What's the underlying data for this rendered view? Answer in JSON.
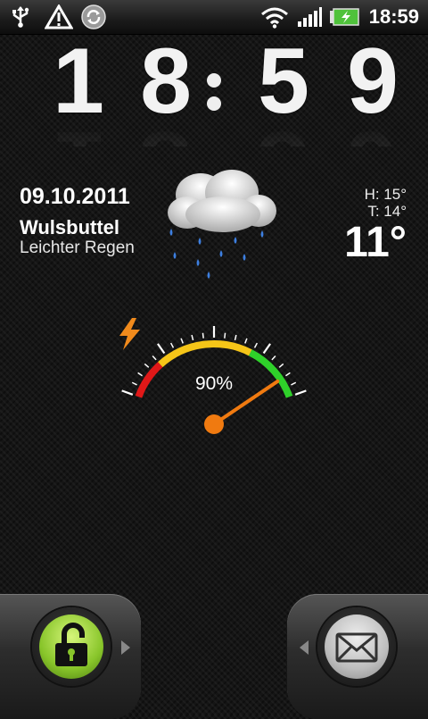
{
  "status_bar": {
    "icons": [
      "usb-icon",
      "warning-icon",
      "sync-icon",
      "wifi-icon",
      "signal-icon",
      "battery-charging-icon"
    ],
    "time": "18:59"
  },
  "clock": {
    "h1": "1",
    "h2": "8",
    "separator": ":",
    "m1": "5",
    "m2": "9"
  },
  "weather": {
    "date": "09.10.2011",
    "city": "Wulsbuttel",
    "condition": "Leichter Regen",
    "high": "H:  15°",
    "low": "T:  14°",
    "current": "11°",
    "icon": "rain-cloud-icon"
  },
  "battery_gauge": {
    "percent_label": "90%",
    "level": 0.9,
    "icon": "lightning-icon"
  },
  "dock": {
    "left_icon": "unlock-icon",
    "right_icon": "envelope-icon"
  }
}
